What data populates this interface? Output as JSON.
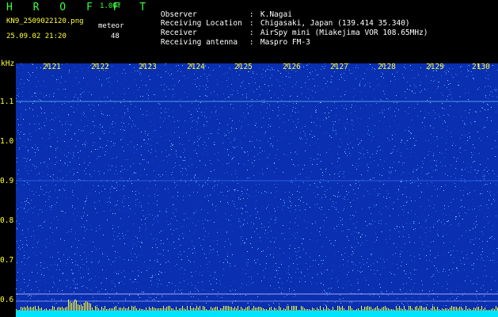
{
  "header": {
    "title": "H R O F F T",
    "version": "1.00f",
    "filename": "KN9_2509022120.png",
    "category": "meteor",
    "timestamp": "25.09.02 21:20",
    "count": "48",
    "meta": [
      {
        "label": "Observer",
        "value": "K.Nagai"
      },
      {
        "label": "Receiving Location",
        "value": "Chigasaki, Japan (139.414 35.340)"
      },
      {
        "label": "Receiver",
        "value": "AirSpy mini (Miakejima VOR 108.65MHz)"
      },
      {
        "label": "Receiving antenna",
        "value": "Maspro FM-3"
      }
    ],
    "separator": ":"
  },
  "spectrogram": {
    "y_unit": "kHz",
    "y_ticks": [
      "1.1",
      "1.0",
      "0.9",
      "0.8",
      "0.7",
      "0.6"
    ],
    "x_ticks": [
      "2121",
      "2122",
      "2123",
      "2124",
      "2125",
      "2126",
      "2127",
      "2128",
      "2129",
      "2130"
    ],
    "colors": {
      "background": "#0a2fb0",
      "noise": "#4aa6ff",
      "axis": "#ffff3a",
      "baseline": "#00e5ff"
    }
  }
}
